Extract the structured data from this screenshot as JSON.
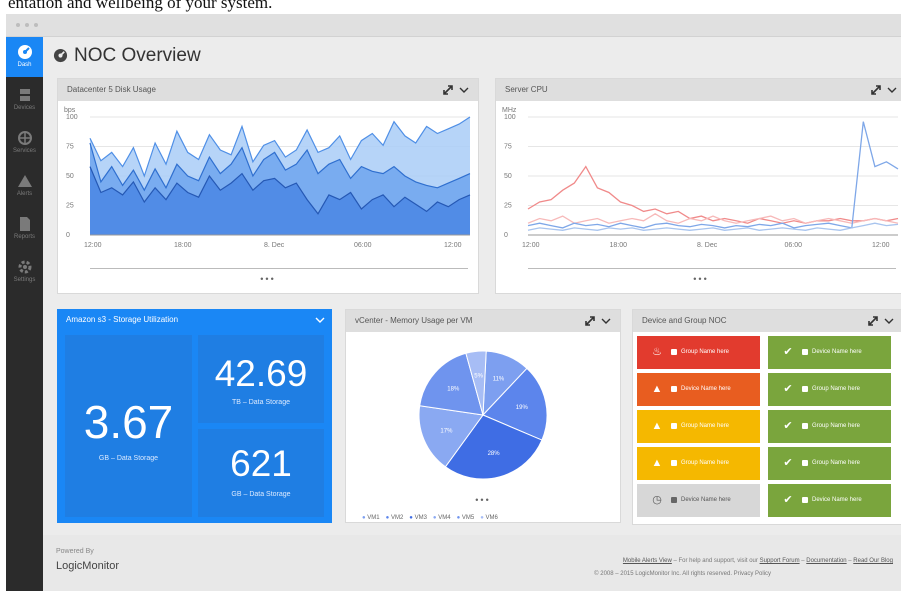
{
  "caption": "entation and wellbeing of your system.",
  "sidebar": {
    "items": [
      {
        "label": "Dash",
        "icon": "dashboard-icon"
      },
      {
        "label": "Devices",
        "icon": "server-icon"
      },
      {
        "label": "Services",
        "icon": "globe-icon"
      },
      {
        "label": "Alerts",
        "icon": "warning-icon"
      },
      {
        "label": "Reports",
        "icon": "document-icon"
      },
      {
        "label": "Settings",
        "icon": "gear-icon"
      }
    ]
  },
  "page": {
    "title": "NOC Overview",
    "title_icon": "dashboard-icon"
  },
  "widgets": {
    "disk": {
      "title": "Datacenter 5 Disk Usage",
      "unit": "bps",
      "chart_data": {
        "type": "area",
        "title": "Datacenter 5 Disk Usage",
        "ylabel": "bps",
        "ylim": [
          0,
          100
        ],
        "yticks": [
          0,
          25,
          50,
          75,
          100
        ],
        "xticks": [
          "12:00",
          "18:00",
          "8. Dec",
          "06:00",
          "12:00"
        ],
        "grid": true,
        "series": [
          {
            "values": [
              82,
              63,
              70,
              58,
              74,
              50,
              78,
              60,
              88,
              70,
              64,
              85,
              72,
              68,
              92,
              62,
              76,
              80,
              66,
              72,
              89,
              70,
              74,
              84,
              64,
              80,
              86,
              76,
              96,
              84,
              78,
              92,
              86,
              90,
              94,
              100
            ]
          },
          {
            "values": [
              78,
              45,
              58,
              42,
              55,
              38,
              56,
              40,
              60,
              50,
              46,
              66,
              52,
              60,
              74,
              50,
              64,
              70,
              55,
              60,
              72,
              52,
              60,
              64,
              48,
              58,
              54,
              52,
              58,
              50,
              45,
              42,
              40,
              44,
              48,
              52
            ]
          },
          {
            "values": [
              58,
              36,
              40,
              34,
              45,
              28,
              40,
              30,
              44,
              36,
              32,
              50,
              38,
              44,
              52,
              38,
              46,
              48,
              40,
              44,
              30,
              18,
              34,
              30,
              36,
              22,
              30,
              34,
              24,
              32,
              26,
              20,
              28,
              24,
              30,
              34
            ]
          }
        ]
      }
    },
    "cpu": {
      "title": "Server CPU",
      "unit": "MHz",
      "chart_data": {
        "type": "line",
        "title": "Server CPU",
        "ylabel": "MHz",
        "ylim": [
          0,
          100
        ],
        "yticks": [
          0,
          25,
          50,
          75,
          100
        ],
        "xticks": [
          "12:00",
          "18:00",
          "8. Dec",
          "06:00",
          "12:00"
        ],
        "grid": true,
        "series": [
          {
            "color": "#f08a8a",
            "values": [
              22,
              28,
              30,
              38,
              44,
              58,
              40,
              36,
              28,
              25,
              20,
              22,
              18,
              20,
              14,
              16,
              12,
              14,
              12,
              10,
              14,
              12,
              10,
              12,
              10,
              12,
              12,
              14,
              12,
              12,
              14,
              12,
              14
            ]
          },
          {
            "color": "#f7b9b9",
            "values": [
              10,
              14,
              12,
              16,
              10,
              12,
              14,
              10,
              12,
              14,
              12,
              18,
              12,
              10,
              14,
              12,
              16,
              12,
              10,
              12,
              14,
              16,
              12,
              14,
              10,
              12,
              14,
              12,
              10,
              12,
              14,
              12,
              10
            ]
          },
          {
            "color": "#7ea7e8",
            "values": [
              8,
              10,
              8,
              6,
              10,
              8,
              9,
              7,
              10,
              8,
              6,
              9,
              10,
              8,
              7,
              9,
              8,
              6,
              8,
              7,
              9,
              8,
              10,
              6,
              8,
              9,
              10,
              8,
              6,
              96,
              58,
              62,
              56
            ]
          },
          {
            "color": "#a8c4ee",
            "values": [
              4,
              6,
              5,
              4,
              6,
              5,
              4,
              6,
              5,
              6,
              4,
              5,
              6,
              5,
              4,
              5,
              6,
              4,
              5,
              6,
              4,
              5,
              6,
              5,
              4,
              6,
              5,
              4,
              6,
              8,
              10,
              8,
              9
            ]
          }
        ]
      }
    },
    "storage": {
      "title": "Amazon s3 - Storage Utilization",
      "tiles": [
        {
          "value": "3.67",
          "label": "GB – Data Storage"
        },
        {
          "value": "42.69",
          "label": "TB – Data Storage"
        },
        {
          "value": "621",
          "label": "GB – Data Storage"
        }
      ]
    },
    "memory": {
      "title": "vCenter - Memory Usage per VM",
      "chart_data": {
        "type": "pie",
        "title": "vCenter - Memory Usage per VM",
        "categories": [
          "VM1",
          "VM2",
          "VM3",
          "VM4",
          "VM5",
          "VM6"
        ],
        "values": [
          11,
          19,
          28,
          17,
          18,
          5
        ],
        "labels": [
          "11%",
          "19%",
          "28%",
          "17%",
          "18%",
          "5%"
        ],
        "colors": [
          "#7d9ff0",
          "#5c85ec",
          "#3f6de4",
          "#8aa9f2",
          "#6f94ee",
          "#a7bdf5"
        ],
        "legend": "bottom"
      }
    },
    "noc": {
      "title": "Device and Group NOC",
      "cells": [
        {
          "color": "#e23b2e",
          "icon": "fire-icon",
          "glyph": "♨",
          "label": "Group Name here"
        },
        {
          "color": "#7aa53d",
          "icon": "check-icon",
          "glyph": "✔",
          "label": "Device Name here"
        },
        {
          "color": "#e85d20",
          "icon": "warning-icon",
          "glyph": "▲",
          "label": "Device Name here"
        },
        {
          "color": "#7aa53d",
          "icon": "check-icon",
          "glyph": "✔",
          "label": "Group Name here"
        },
        {
          "color": "#f5b800",
          "icon": "warning-icon",
          "glyph": "▲",
          "label": "Group Name here"
        },
        {
          "color": "#7aa53d",
          "icon": "check-icon",
          "glyph": "✔",
          "label": "Group Name here"
        },
        {
          "color": "#f5b800",
          "icon": "warning-icon",
          "glyph": "▲",
          "label": "Group Name here"
        },
        {
          "color": "#7aa53d",
          "icon": "check-icon",
          "glyph": "✔",
          "label": "Group Name here"
        },
        {
          "color": "#d7d7d7",
          "icon": "clock-icon",
          "glyph": "◷",
          "label": "Device Name here",
          "dark": true
        },
        {
          "color": "#7aa53d",
          "icon": "check-icon",
          "glyph": "✔",
          "label": "Device Name here"
        }
      ]
    }
  },
  "footer": {
    "powered_by": "Powered By",
    "brand": "LogicMonitor",
    "links": [
      "Mobile Alerts View",
      "Support Forum",
      "Documentation",
      "Read Our Blog"
    ],
    "help_text_a": " – For help and support, visit our ",
    "sep": " – ",
    "copyright": "© 2008 – 2015 LogicMonitor Inc. All rights reserved. Privacy Policy"
  },
  "colors": {
    "accent": "#1a87f5",
    "sidebar": "#2b2b2b",
    "error": "#e23b2e",
    "warning": "#f5b800",
    "ok": "#7aa53d"
  }
}
